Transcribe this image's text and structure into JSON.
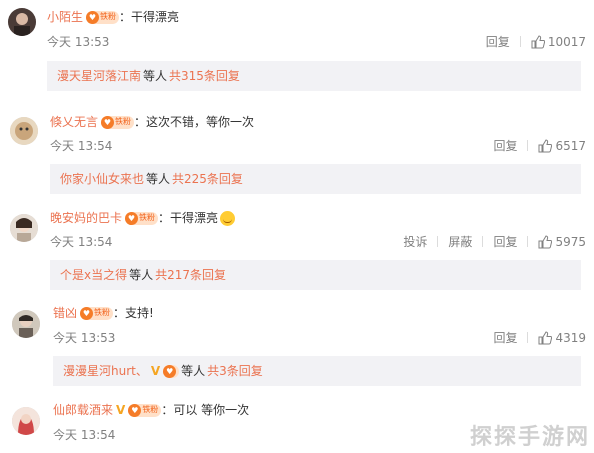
{
  "actions": {
    "reply": "回复",
    "report": "投诉",
    "block": "屏蔽"
  },
  "fan_badge": "铁粉",
  "comments": [
    {
      "user": "小陌生",
      "text": "干得漂亮",
      "time": "今天 13:53",
      "likes": "10017",
      "reply_user": "漫天星河落江南",
      "reply_mid": "等人",
      "reply_count": "共315条回复",
      "avatar_color": "#4a3b37"
    },
    {
      "user": "倏乂无言",
      "text": "这次不错，等你一次",
      "time": "今天 13:54",
      "likes": "6517",
      "reply_user": "你家小仙女来也",
      "reply_mid": "等人",
      "reply_count": "共225条回复",
      "avatar_color": "#c9a57b"
    },
    {
      "user": "晚安妈的巴卡",
      "text": "干得漂亮",
      "time": "今天 13:54",
      "likes": "5975",
      "reply_user": "个是x当之得",
      "reply_mid": "等人",
      "reply_count": "共217条回复",
      "avatar_color": "#d8c8b8"
    },
    {
      "user": "错凶",
      "text": "支持!",
      "time": "今天 13:53",
      "likes": "4319",
      "reply_user": "漫漫星河hurt、",
      "reply_mid": "等人",
      "reply_count": "共3条回复",
      "avatar_color": "#b8b0a0"
    },
    {
      "user": "仙郎载酒来",
      "text": "可以 等你一次",
      "time": "今天 13:54",
      "avatar_color": "#d04848"
    }
  ],
  "watermark": "探探手游网"
}
